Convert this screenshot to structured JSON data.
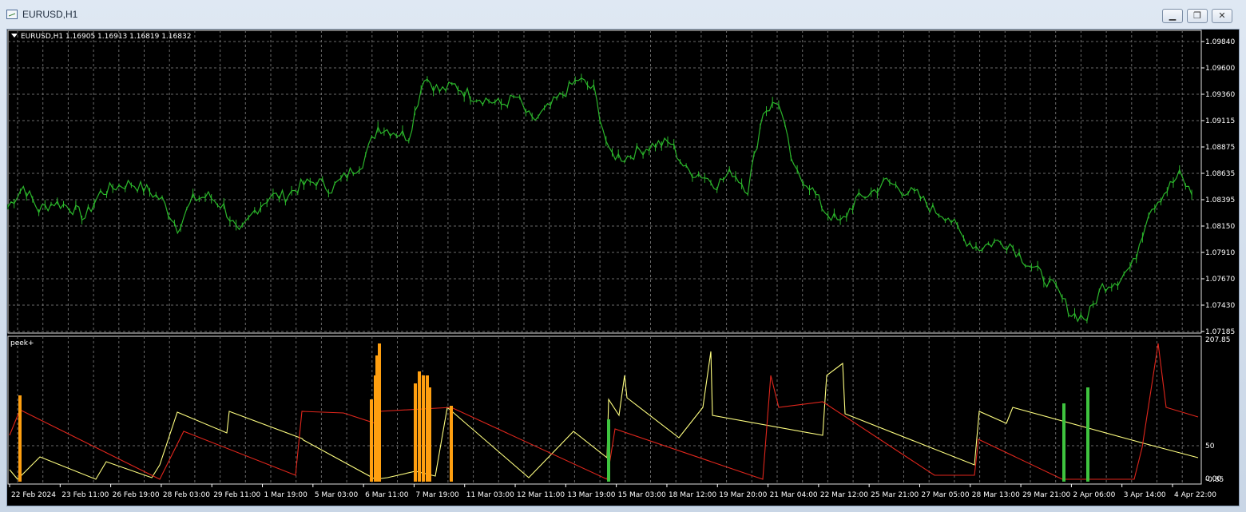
{
  "window": {
    "title": "EURUSD,H1",
    "minimize_glyph": "▁",
    "restore_glyph": "❐",
    "close_glyph": "✕"
  },
  "main_chart": {
    "header": "EURUSD,H1  1.16905 1.16913 1.16819 1.16832",
    "price_labels": [
      "1.09840",
      "1.09600",
      "1.09360",
      "1.09115",
      "1.08875",
      "1.08635",
      "1.08395",
      "1.08150",
      "1.07910",
      "1.07670",
      "1.07430",
      "1.07185"
    ],
    "series_color": "#2bb52b"
  },
  "indicator": {
    "name": "peek+",
    "scale_labels": [
      "207.85",
      "50",
      "0.00",
      "-0.85"
    ],
    "colors": {
      "yellow": "#ffff80",
      "red": "#e0261c",
      "orange": "#ff9f10",
      "green": "#3fc43f"
    }
  },
  "time_labels": [
    "22 Feb 2024",
    "23 Feb 11:00",
    "26 Feb 19:00",
    "28 Feb 03:00",
    "29 Feb 11:00",
    "1 Mar 19:00",
    "5 Mar 03:00",
    "6 Mar 11:00",
    "7 Mar 19:00",
    "11 Mar 03:00",
    "12 Mar 11:00",
    "13 Mar 19:00",
    "15 Mar 03:00",
    "18 Mar 12:00",
    "19 Mar 20:00",
    "21 Mar 04:00",
    "22 Mar 12:00",
    "25 Mar 21:00",
    "27 Mar 05:00",
    "28 Mar 13:00",
    "29 Mar 21:00",
    "2 Apr 06:00",
    "3 Apr 14:00",
    "4 Apr 22:00"
  ],
  "chart_data": {
    "type": "line",
    "title": "EURUSD,H1",
    "ylim": [
      1.0713,
      1.0998
    ],
    "series": [
      {
        "values": [
          1.0832,
          1.0851,
          1.0829,
          1.0836,
          1.0832,
          1.0822,
          1.0845,
          1.0851,
          1.0854,
          1.0848,
          1.0838,
          1.0812,
          1.0839,
          1.0842,
          1.0832,
          1.0805,
          1.0828,
          1.0842,
          1.0842,
          1.0852,
          1.0856,
          1.0849,
          1.0862,
          1.0874,
          1.0907,
          1.0903,
          1.0898,
          1.0955,
          1.0941,
          1.0946,
          1.0937,
          1.0933,
          1.0928,
          1.0935,
          1.0912,
          1.0924,
          1.0938,
          1.0952,
          1.0942,
          1.0882,
          1.0878,
          1.0885,
          1.0891,
          1.0892,
          1.0866,
          1.0862,
          1.0853,
          1.0865,
          1.0848,
          1.0922,
          1.0931,
          1.0866,
          1.0852,
          1.0828,
          1.0816,
          1.0838,
          1.0845,
          1.0856,
          1.0848,
          1.0843,
          1.0829,
          1.0823,
          1.0802,
          1.0793,
          1.0799,
          1.0797,
          1.0781,
          1.0768,
          1.0754,
          1.0731,
          1.0727,
          1.0757,
          1.0763,
          1.0778,
          1.0828,
          1.0845,
          1.0862,
          1.0839
        ]
      }
    ]
  }
}
